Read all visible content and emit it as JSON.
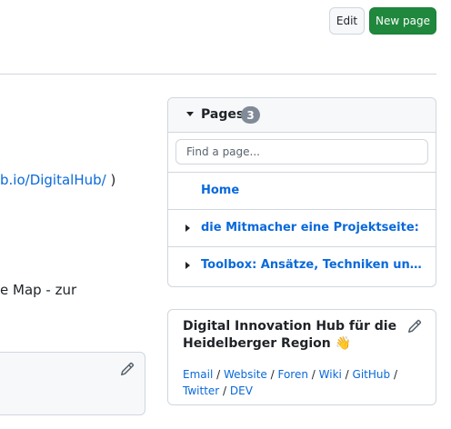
{
  "header": {
    "edit_label": "Edit",
    "new_page_label": "New page"
  },
  "content": {
    "link_fragment": "b.io/DigitalHub/",
    "link_suffix": " )",
    "text_fragment": "e Map - zur"
  },
  "pages": {
    "title": "Pages",
    "count": "3",
    "search_placeholder": "Find a page...",
    "items": [
      {
        "label": "Home"
      },
      {
        "label": "die Mitmacher eine Projektseite:"
      },
      {
        "label": "Toolbox: Ansätze, Techniken und Tools"
      }
    ]
  },
  "sidebar": {
    "title": "Digital Innovation Hub für die Heidelberger Region 👋",
    "links": [
      "Email",
      "Website",
      "Foren",
      "Wiki",
      "GitHub",
      "Twitter",
      "DEV"
    ],
    "separator": " / "
  }
}
